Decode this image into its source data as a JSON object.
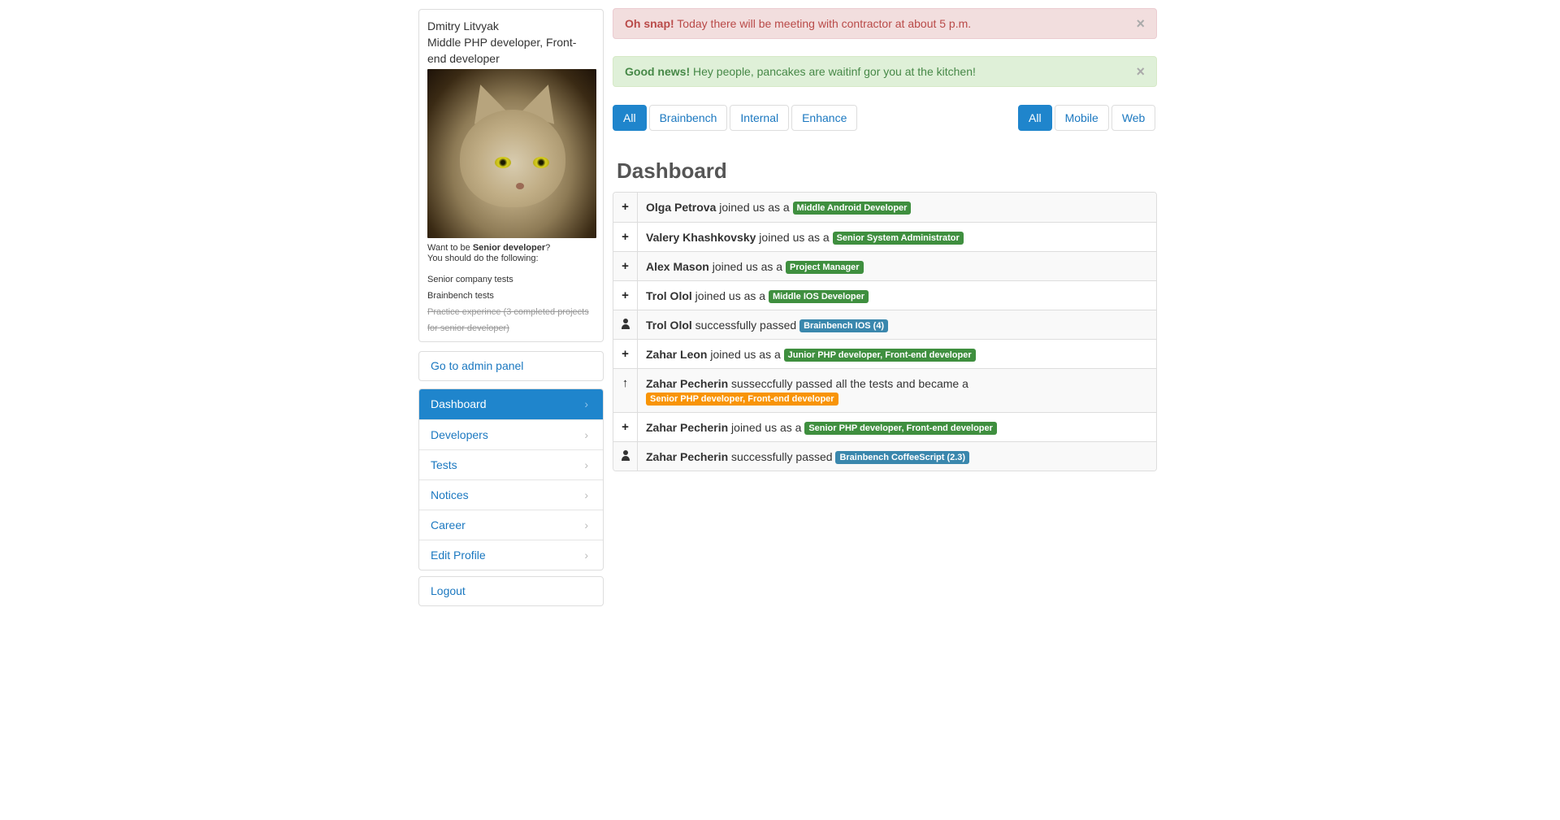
{
  "profile": {
    "name": "Dmitry Litvyak",
    "role_line1": "Middle PHP developer, Front-",
    "role_line2": "end developer",
    "want_prefix": "Want to be ",
    "want_target": "Senior developer",
    "want_suffix": "?",
    "want_line2": "You should do the following:",
    "todo": [
      {
        "text": "Senior company tests",
        "done": false
      },
      {
        "text": "Brainbench tests",
        "done": false
      },
      {
        "text": "Practice experince (3 completed projects for senior developer)",
        "done": true
      }
    ]
  },
  "admin_link": "Go to admin panel",
  "nav": [
    {
      "label": "Dashboard",
      "active": true
    },
    {
      "label": "Developers",
      "active": false
    },
    {
      "label": "Tests",
      "active": false
    },
    {
      "label": "Notices",
      "active": false
    },
    {
      "label": "Career",
      "active": false
    },
    {
      "label": "Edit Profile",
      "active": false
    }
  ],
  "logout": "Logout",
  "alerts": {
    "error": {
      "strong": "Oh snap!",
      "text": " Today there will be meeting with contractor at about 5 p.m.",
      "close": "×"
    },
    "success": {
      "strong": "Good news!",
      "text": " Hey people, pancakes are waitinf gor you at the kitchen!",
      "close": "×"
    }
  },
  "filters_left": [
    "All",
    "Brainbench",
    "Internal",
    "Enhance"
  ],
  "filters_right": [
    "All",
    "Mobile",
    "Web"
  ],
  "page_title": "Dashboard",
  "activity": [
    {
      "icon": "plus",
      "name": "Olga Petrova",
      "action": " joined us as a ",
      "label": "Middle Android Developer",
      "color": "green"
    },
    {
      "icon": "plus",
      "name": "Valery Khashkovsky",
      "action": " joined us as a ",
      "label": "Senior System Administrator",
      "color": "green"
    },
    {
      "icon": "plus",
      "name": "Alex Mason",
      "action": " joined us as a ",
      "label": "Project Manager",
      "color": "green"
    },
    {
      "icon": "plus",
      "name": "Trol Olol",
      "action": " joined us as a ",
      "label": "Middle IOS Developer",
      "color": "green"
    },
    {
      "icon": "user",
      "name": "Trol Olol",
      "action": " successfully passed ",
      "label": "Brainbench IOS (4)",
      "color": "blue"
    },
    {
      "icon": "plus",
      "name": "Zahar Leon",
      "action": " joined us as a ",
      "label": "Junior PHP developer, Front-end developer",
      "color": "green"
    },
    {
      "icon": "arrow-up",
      "name": "Zahar Pecherin",
      "action": " susseccfully passed all the tests and became a ",
      "label": "Senior PHP developer, Front-end developer",
      "color": "orange",
      "break": true
    },
    {
      "icon": "plus",
      "name": "Zahar Pecherin",
      "action": " joined us as a ",
      "label": "Senior PHP developer, Front-end developer",
      "color": "green"
    },
    {
      "icon": "user",
      "name": "Zahar Pecherin",
      "action": " successfully passed ",
      "label": "Brainbench CoffeeScript (2.3)",
      "color": "blue"
    }
  ]
}
